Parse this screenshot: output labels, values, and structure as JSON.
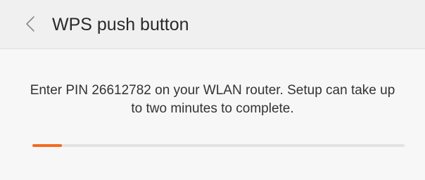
{
  "header": {
    "title": "WPS push button",
    "back_icon": "chevron-left-icon"
  },
  "main": {
    "message": "Enter PIN 26612782 on your WLAN router. Setup can take up to two minutes to complete.",
    "progress": {
      "value_percent": 8,
      "fill_color": "#f26b21",
      "track_color": "#e3e3e3"
    }
  },
  "colors": {
    "accent": "#f26b21",
    "header_bg": "#f0f0f0",
    "page_bg": "#f7f7f7"
  }
}
